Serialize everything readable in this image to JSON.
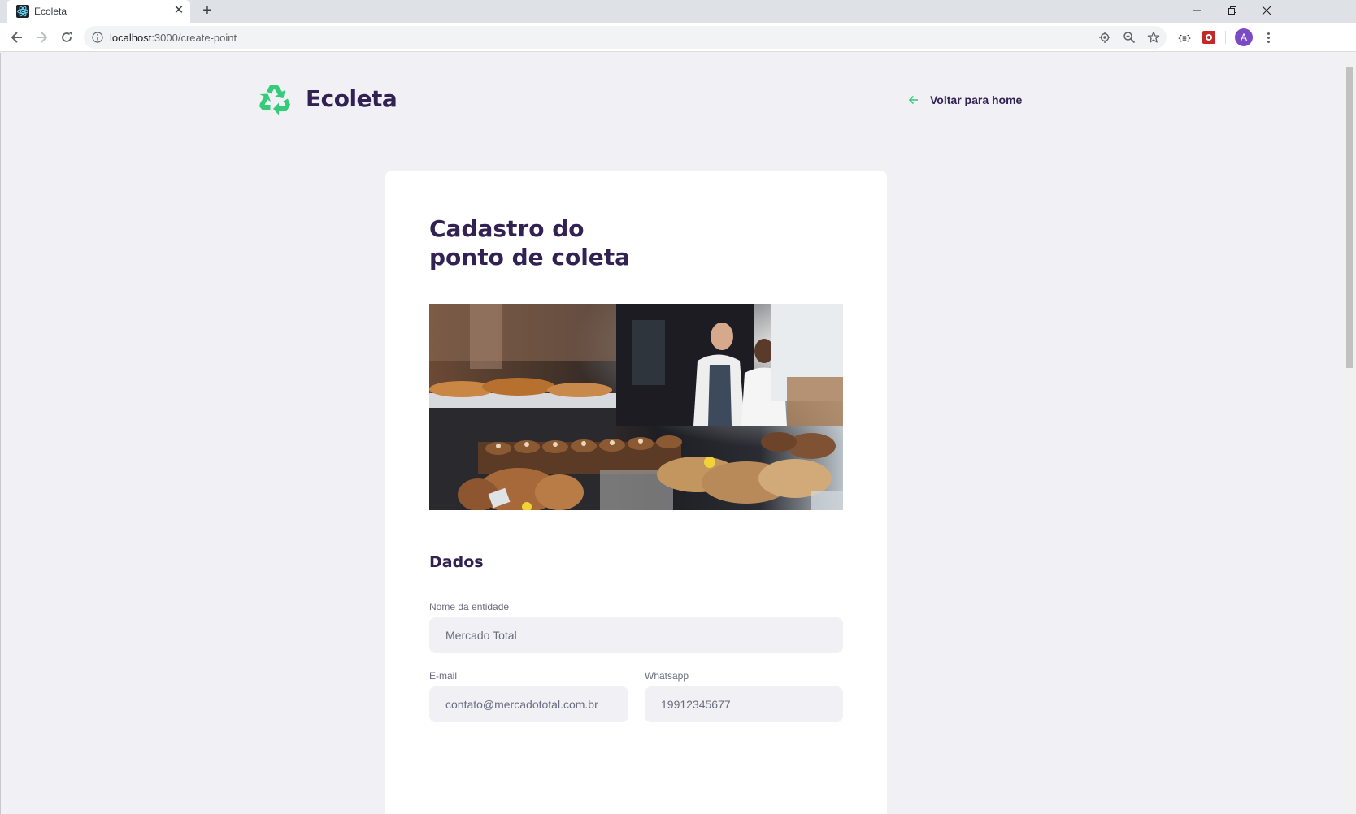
{
  "browser": {
    "tab_title": "Ecoleta",
    "tab_close": "✕",
    "new_tab": "+",
    "url_host": "localhost",
    "url_path": ":3000/create-point",
    "profile_initial": "A"
  },
  "header": {
    "logo_text": "Ecoleta",
    "back_link": "Voltar para home"
  },
  "form": {
    "title_line1": "Cadastro do",
    "title_line2": "ponto de coleta",
    "section_title": "Dados",
    "fields": {
      "name": {
        "label": "Nome da entidade",
        "value": "Mercado Total"
      },
      "email": {
        "label": "E-mail",
        "value": "contato@mercadototal.com.br"
      },
      "whatsapp": {
        "label": "Whatsapp",
        "value": "19912345677"
      }
    }
  },
  "colors": {
    "brand_title": "#322153",
    "accent_green": "#34cb79",
    "page_bg": "#f0f0f5",
    "input_bg": "#f0f0f5"
  }
}
